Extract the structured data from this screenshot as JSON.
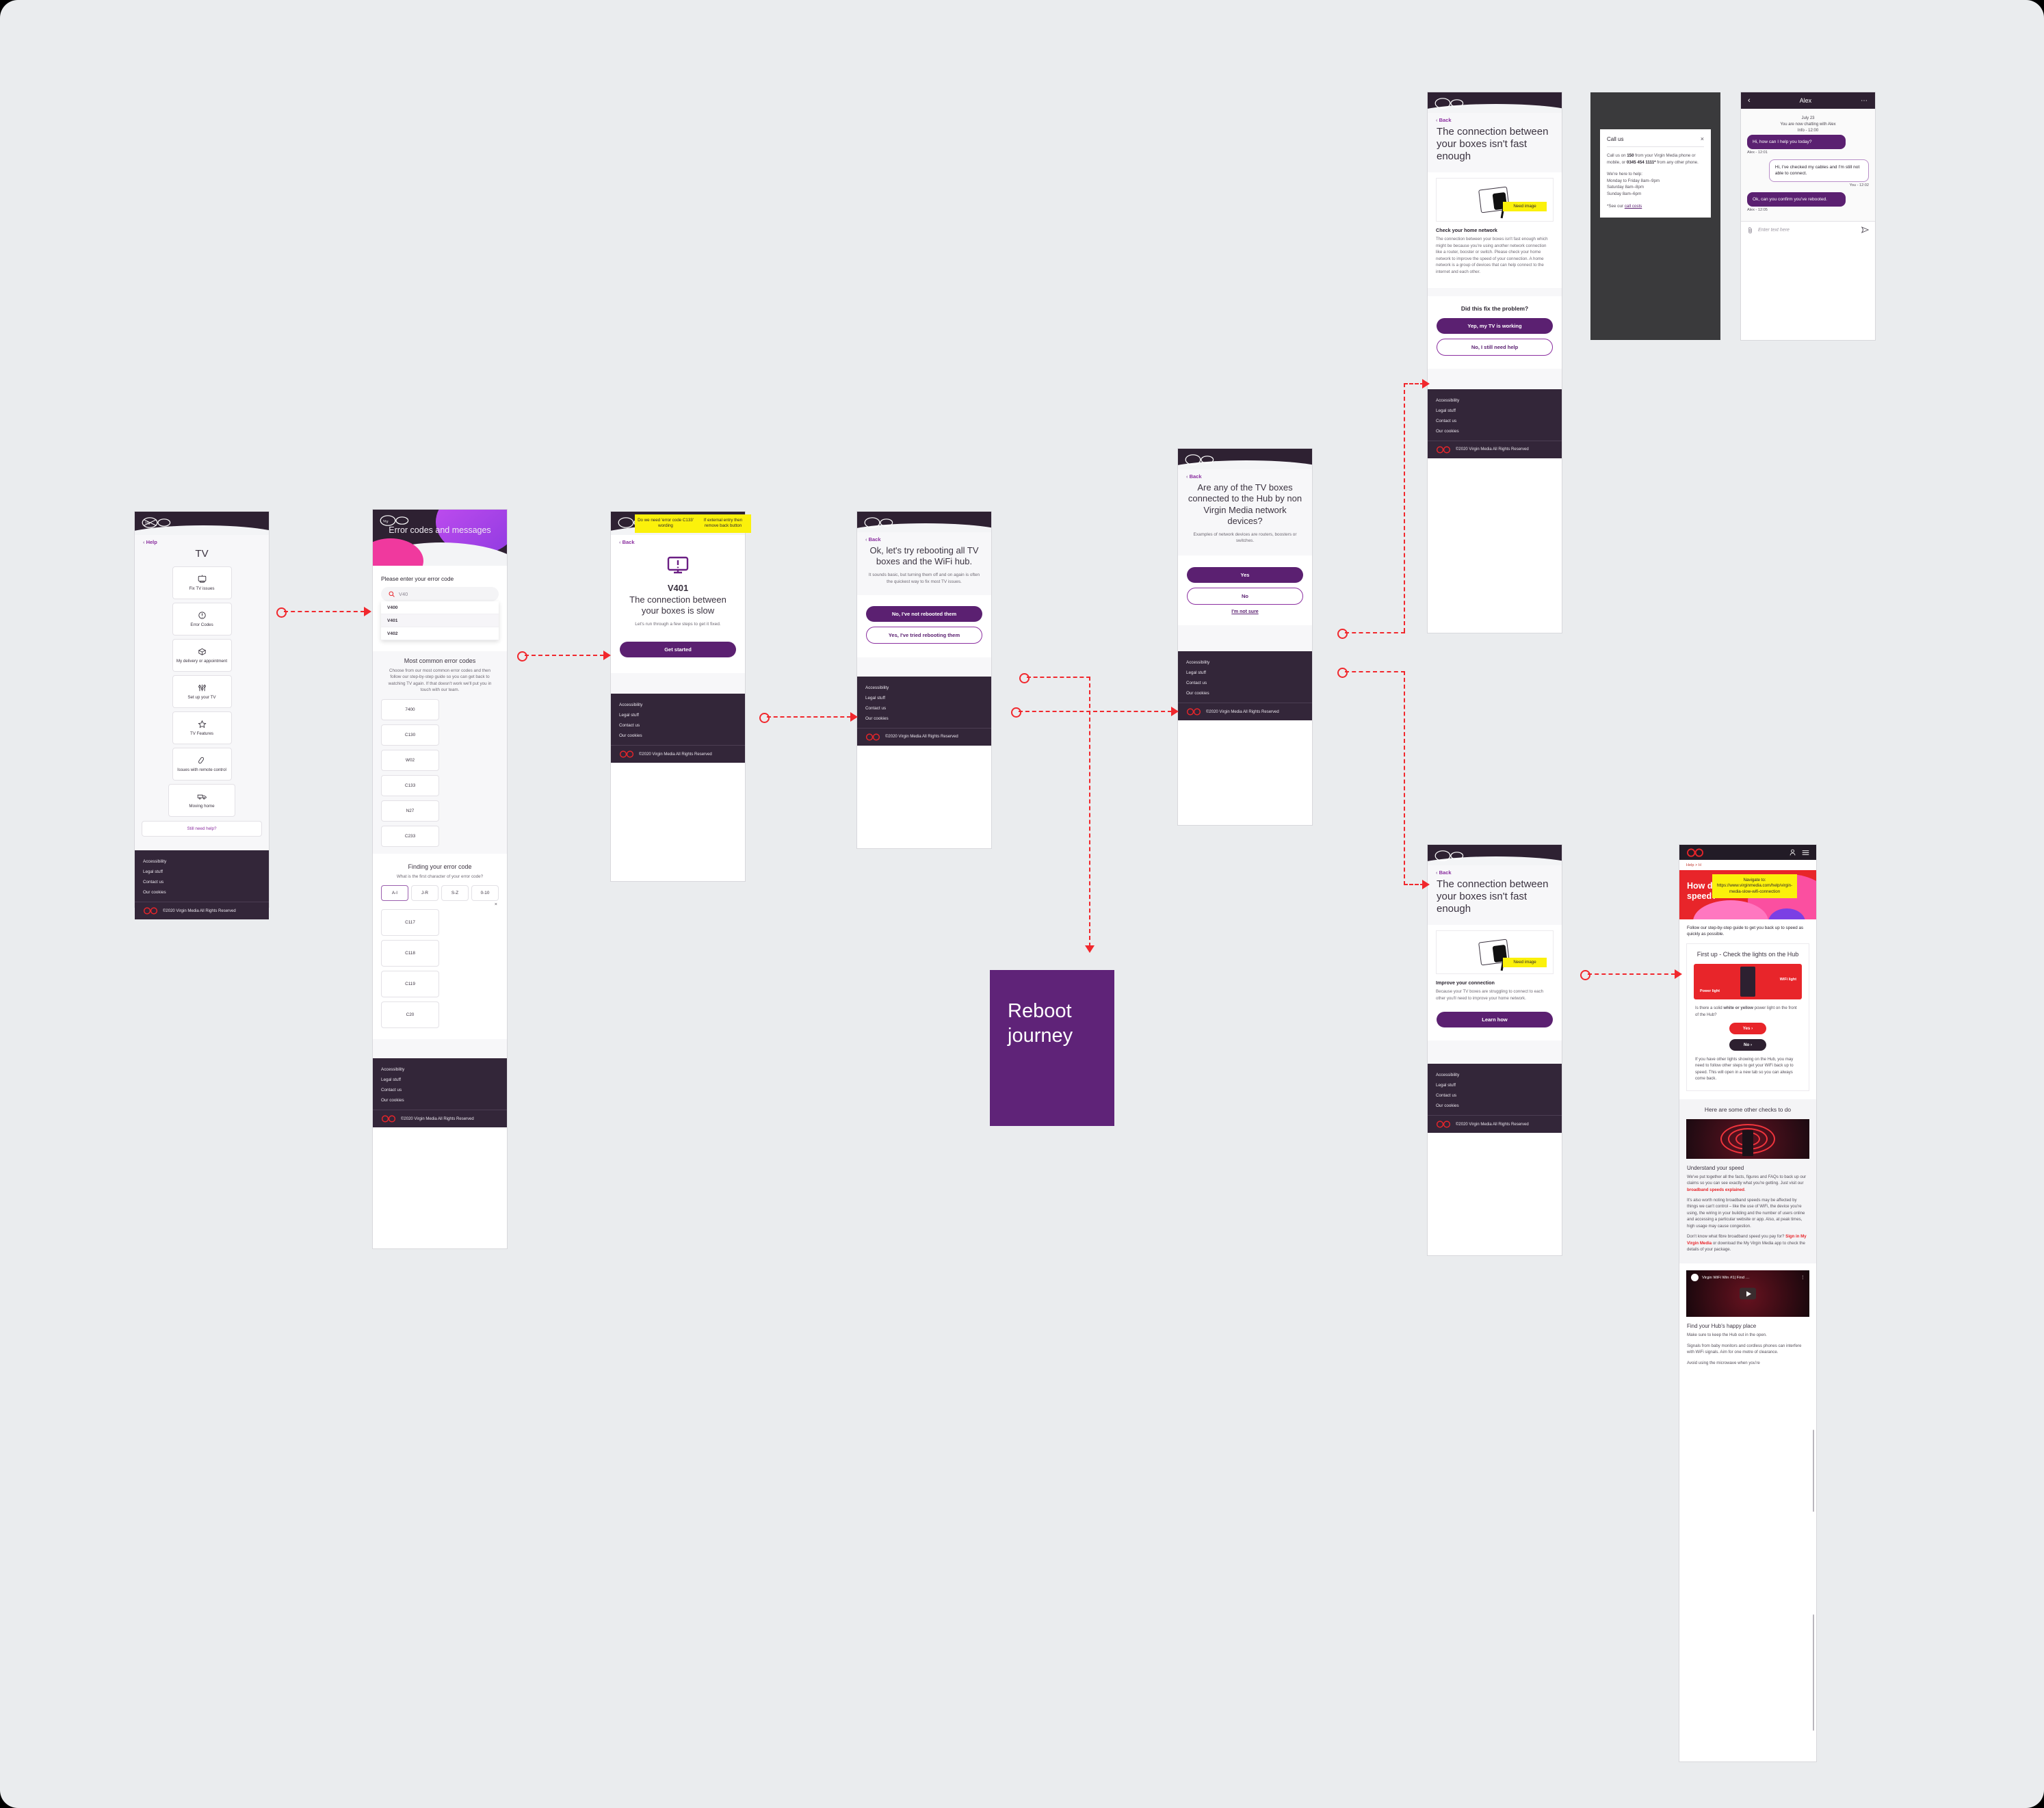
{
  "canvas": {
    "label": "Reboot journey",
    "bg": "#eaecee",
    "accent": "#5b2071",
    "arrow_color": "#f1282d",
    "note_color": "#fbf10b"
  },
  "common": {
    "back": "Back",
    "back_chevron": "‹",
    "footer_links": [
      "Accessibility",
      "Legal stuff",
      "Contact us",
      "Our cookies"
    ],
    "copyright": "©2020 Virgin Media  All Rights Reserved"
  },
  "screen_tv": {
    "back_label": "Help",
    "title": "TV",
    "tiles": [
      {
        "label": "Fix TV issues",
        "icon": "tv-icon"
      },
      {
        "label": "Error Codes",
        "icon": "alert-circle-icon"
      },
      {
        "label": "My delivery or appointment",
        "icon": "box-icon"
      },
      {
        "label": "Set up your TV",
        "icon": "sliders-icon"
      },
      {
        "label": "TV Features",
        "icon": "star-icon"
      },
      {
        "label": "Issues with remote control",
        "icon": "remote-icon"
      },
      {
        "label": "Moving home",
        "icon": "van-icon"
      }
    ],
    "still_need_help": "Still need help?"
  },
  "screen_error_codes": {
    "hero_title": "Error codes and messages",
    "prompt": "Please enter your error code",
    "search_value": "V40",
    "search_icon": "search-icon",
    "suggestions": [
      "V400",
      "V401",
      "V402"
    ],
    "selected_suggestion": "V401",
    "common_title": "Most common error codes",
    "common_body": "Choose from our most common error codes and then follow our step-by-step guide so you can get back to watching TV again. If that doesn't work we'll put you in touch with our team.",
    "common_codes": [
      "7400",
      "C130",
      "W02",
      "C133",
      "N27",
      "C233"
    ],
    "finding_title": "Finding your error code",
    "finding_question": "What is the first character of your error code?",
    "range_chips": [
      "A-I",
      "J-R",
      "S-Z",
      "0-10"
    ],
    "range_selected": "A-I",
    "close_icon": "close-icon",
    "filtered_codes": [
      "C117",
      "C118",
      "C119",
      "C20"
    ]
  },
  "screen_v401": {
    "notes": [
      "Do we need 'error code C133' wording",
      "If external entry then remove back button"
    ],
    "icon": "tv-alert-icon",
    "code": "V401",
    "title": "The connection between your boxes is slow",
    "sub": "Let's run through a few steps to get it fixed.",
    "cta": "Get started"
  },
  "screen_reboot_ask": {
    "title": "Ok, let's try rebooting all TV boxes and the WiFi hub.",
    "sub": "It sounds basic, but turning them off and on again is often the quickest way to fix most TV issues.",
    "primary": "No, I've not rebooted them",
    "secondary": "Yes, I've tried rebooting them"
  },
  "screen_network_ask": {
    "title": "Are any of the TV boxes connected to the Hub by non Virgin Media network devices?",
    "sub": "Examples of network devices are routers, boosters or switches.",
    "primary": "Yes",
    "secondary": "No",
    "link": "I'm not sure"
  },
  "screen_check_network": {
    "title": "The connection between your boxes isn't fast enough",
    "image_note": "Need image",
    "section_title": "Check your home network",
    "body": "The connection between your boxes isn't fast enough which might be because you're using another network connection like a router, booster or switch. Please check your home network to improve the speed of your connection. A home network is a group of devices that can help connect to the internet and each other.",
    "question": "Did this fix the problem?",
    "primary": "Yep, my TV is working",
    "secondary": "No, I still need help"
  },
  "screen_improve": {
    "title": "The connection between your boxes isn't fast enough",
    "image_note": "Need image",
    "section_title": "Improve your connection",
    "body": "Because your TV boxes are struggling to connect to each other you'll need to improve your home network.",
    "cta": "Learn how"
  },
  "screen_call_us": {
    "title": "Call us",
    "close_icon": "close-icon",
    "body_1_pre": "Call us on ",
    "body_1_num": "150",
    "body_1_mid": " from your Virgin Media phone or mobile, or ",
    "body_1_num2": "0345 454 1111*",
    "body_1_post": " from any other phone.",
    "hours_title": "We're here to help:",
    "hours": [
      "Monday to Friday 8am–9pm",
      "Saturday 8am–8pm",
      "Sunday 8am–6pm"
    ],
    "footnote_pre": "*See our ",
    "footnote_link": "call costs"
  },
  "screen_chat": {
    "back_icon": "chevron-left-icon",
    "agent": "Alex",
    "menu_icon": "more-icon",
    "date": "July 23",
    "intro": "You are now chatting with Alex",
    "intro_stamp": "Info - 12:00",
    "messages": [
      {
        "from": "agent",
        "text": "Hi, how can I help you today?",
        "stamp": "Alex - 12:01"
      },
      {
        "from": "you",
        "text": "Hi, I've checked my cables and I'm still not able to connect.",
        "stamp": "You - 12:02"
      },
      {
        "from": "agent",
        "text": "Ok, can you confirm you've rebooted.",
        "stamp": "Alex - 12:05"
      }
    ],
    "attach_icon": "paperclip-icon",
    "send_icon": "send-icon",
    "input_placeholder": "Enter text here"
  },
  "screen_wifi_speed": {
    "account_icon": "account-icon",
    "menu_icon": "hamburger-icon",
    "breadcrumb": "Help > H",
    "note": "Navigate to: https://www.virginmedia.com/help/virgin-media-slow-wifi-connection",
    "hero_title": "How do I improve my WiFi speed?",
    "intro": "Follow our step-by-step guide to get you back up to speed as quickly as possible.",
    "card_title": "First up - Check the lights on the Hub",
    "label_power": "Power light",
    "label_wifi": "WiFi light",
    "card_question_pre": "Is there a solid ",
    "card_question_b": "white or yellow",
    "card_question_post": " power light on the front of the Hub?",
    "yes": "Yes ›",
    "no": "No ›",
    "card_note": "If you have other lights showing on the Hub, you may need to follow other steps to get your WiFi back up to speed. This will open in a new tab so you can always come back.",
    "other_checks_title": "Here are some other checks to do",
    "speed_title": "Understand your speed",
    "speed_p1_pre": "We've put together all the facts, figures and FAQs to back up our claims so you can see exactly what you're getting. Just visit our ",
    "speed_p1_link": "broadband speeds explained",
    "speed_p1_post": ".",
    "speed_p2": "It's also worth noting broadband speeds may be affected by things we can't control – like the use of WiFi, the device you're using, the wiring in your building and the number of users online and accessing a particular website or app. Also, at peak times, high usage may cause congestion.",
    "speed_p3_pre": "Don't know what fibre broadband speed you pay for? ",
    "speed_p3_link": "Sign in My Virgin Media",
    "speed_p3_post": " or download the My Virgin Media app to check the details of your package.",
    "video_title": "Virgin WiFi Win #1| Find …",
    "video_menu_icon": "kebab-icon",
    "play_icon": "play-icon",
    "hub_title": "Find your Hub's happy place",
    "hub_p1": "Make sure to keep the Hub out in the open.",
    "hub_p2": "Signals from baby monitors and cordless phones can interfere with WiFi signals. Aim for one metre of clearance.",
    "hub_p3": "Avoid using the microwave when you're"
  }
}
